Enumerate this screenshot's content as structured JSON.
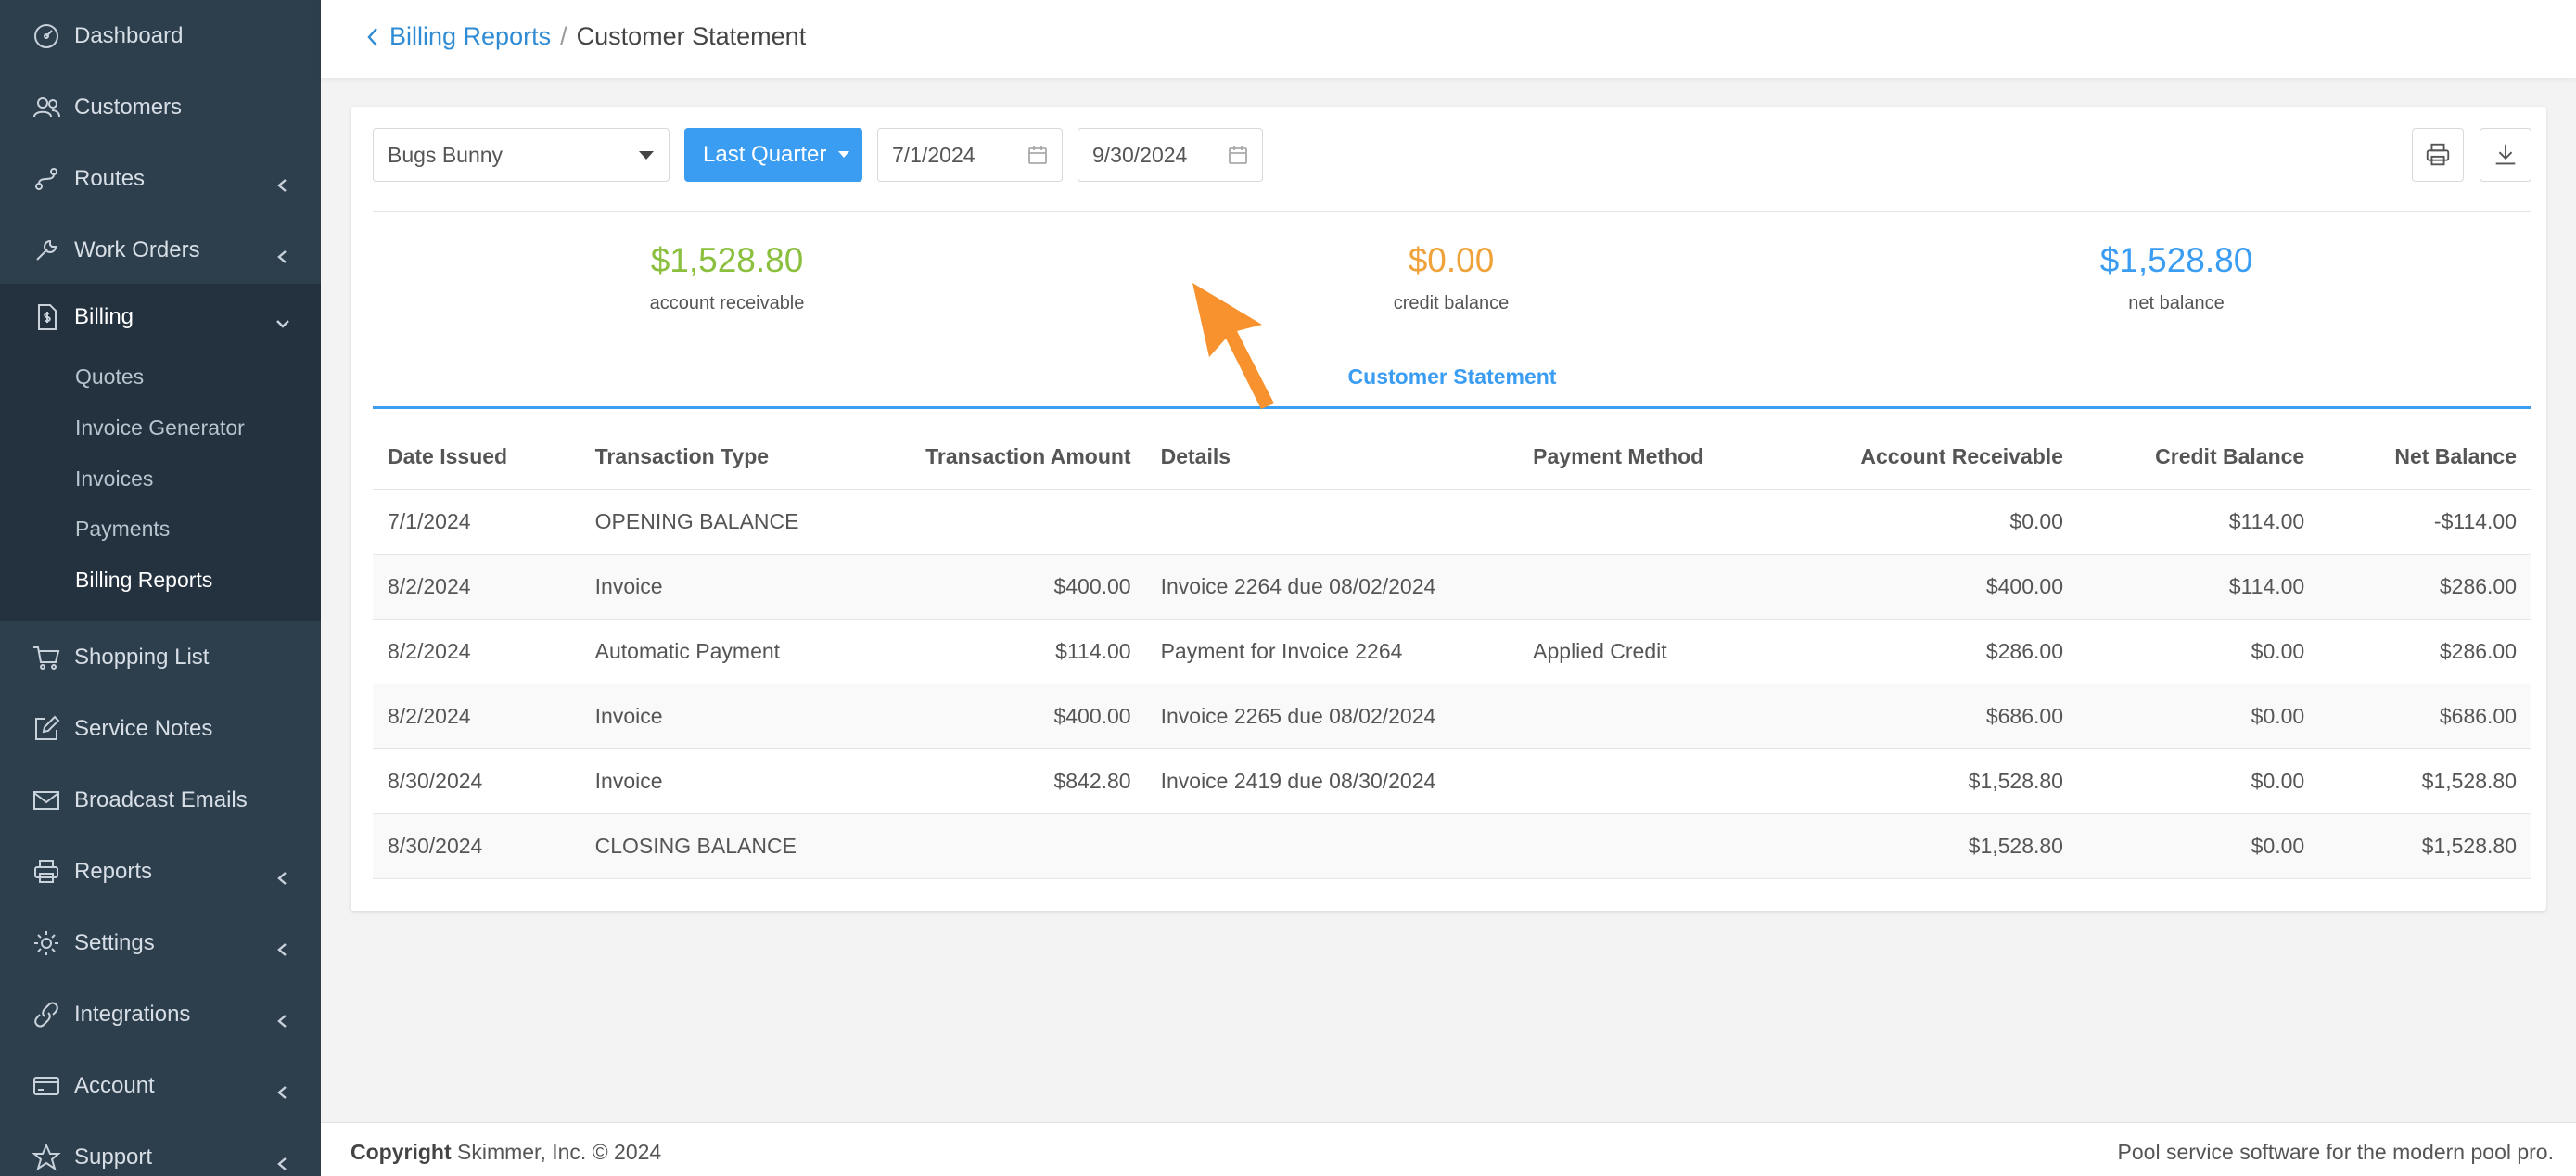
{
  "sidebar": {
    "items": [
      {
        "label": "Dashboard",
        "icon": "gauge-icon",
        "chevron": false
      },
      {
        "label": "Customers",
        "icon": "people-icon",
        "chevron": false
      },
      {
        "label": "Routes",
        "icon": "route-icon",
        "chevron": true
      },
      {
        "label": "Work Orders",
        "icon": "wrench-icon",
        "chevron": true
      },
      {
        "label": "Billing",
        "icon": "dollar-file-icon",
        "chevron": true,
        "active": true
      },
      {
        "label": "Shopping List",
        "icon": "cart-icon",
        "chevron": false
      },
      {
        "label": "Service Notes",
        "icon": "pencil-square-icon",
        "chevron": false
      },
      {
        "label": "Broadcast Emails",
        "icon": "envelope-icon",
        "chevron": false
      },
      {
        "label": "Reports",
        "icon": "printer-icon",
        "chevron": true
      },
      {
        "label": "Settings",
        "icon": "gear-icon",
        "chevron": true
      },
      {
        "label": "Integrations",
        "icon": "link-icon",
        "chevron": true
      },
      {
        "label": "Account",
        "icon": "card-icon",
        "chevron": true
      },
      {
        "label": "Support",
        "icon": "star-icon",
        "chevron": true
      }
    ],
    "billing_sub": [
      "Quotes",
      "Invoice Generator",
      "Invoices",
      "Payments",
      "Billing Reports"
    ]
  },
  "header": {
    "breadcrumb_link": "Billing Reports",
    "breadcrumb_sep": "/",
    "breadcrumb_current": "Customer Statement"
  },
  "filters": {
    "customer": "Bugs Bunny",
    "period": "Last Quarter",
    "start_date": "7/1/2024",
    "end_date": "9/30/2024"
  },
  "summary": {
    "account_receivable": "$1,528.80",
    "account_receivable_label": "account receivable",
    "credit_balance": "$0.00",
    "credit_balance_label": "credit balance",
    "net_balance": "$1,528.80",
    "net_balance_label": "net balance"
  },
  "statement": {
    "title": "Customer Statement",
    "columns": [
      "Date Issued",
      "Transaction Type",
      "Transaction Amount",
      "Details",
      "Payment Method",
      "Account Receivable",
      "Credit Balance",
      "Net Balance"
    ],
    "rows": [
      [
        "7/1/2024",
        "OPENING BALANCE",
        "",
        "",
        "",
        "$0.00",
        "$114.00",
        "-$114.00"
      ],
      [
        "8/2/2024",
        "Invoice",
        "$400.00",
        "Invoice 2264 due 08/02/2024",
        "",
        "$400.00",
        "$114.00",
        "$286.00"
      ],
      [
        "8/2/2024",
        "Automatic Payment",
        "$114.00",
        "Payment for Invoice 2264",
        "Applied Credit",
        "$286.00",
        "$0.00",
        "$286.00"
      ],
      [
        "8/2/2024",
        "Invoice",
        "$400.00",
        "Invoice 2265 due 08/02/2024",
        "",
        "$686.00",
        "$0.00",
        "$686.00"
      ],
      [
        "8/30/2024",
        "Invoice",
        "$842.80",
        "Invoice 2419 due 08/30/2024",
        "",
        "$1,528.80",
        "$0.00",
        "$1,528.80"
      ],
      [
        "8/30/2024",
        "CLOSING BALANCE",
        "",
        "",
        "",
        "$1,528.80",
        "$0.00",
        "$1,528.80"
      ]
    ]
  },
  "footer": {
    "copyright_bold": "Copyright",
    "copyright_rest": "Skimmer, Inc. © 2024",
    "tagline": "Pool service software for the modern pool pro."
  },
  "colors": {
    "accent": "#3b9df2",
    "receivable": "#8bbf3e",
    "credit": "#f0a23a",
    "annotation_arrow": "#f7922e",
    "sidebar": "#2d3e4d"
  }
}
